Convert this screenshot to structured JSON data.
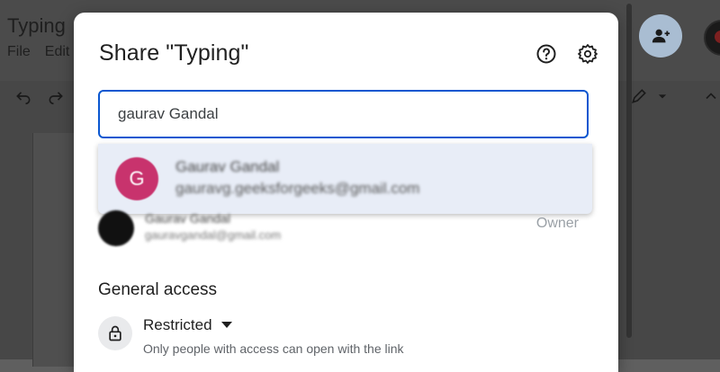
{
  "document": {
    "title": "Typing",
    "menu": [
      "File",
      "Edit"
    ]
  },
  "dialog": {
    "title": "Share \"Typing\"",
    "help_icon": "help-circle-icon",
    "settings_icon": "gear-icon"
  },
  "search": {
    "value": "gaurav Gandal"
  },
  "suggestion": {
    "initial": "G",
    "name": "Gaurav Gandal",
    "email": "gauravg.geeksforgeeks@gmail.com",
    "avatar_color": "#c8336d"
  },
  "owner": {
    "name": "Gaurav Gandal",
    "email": "gauravgandal@gmail.com",
    "role": "Owner"
  },
  "general_access": {
    "heading": "General access",
    "value": "Restricted",
    "description": "Only people with access can open with the link",
    "icon": "lock-icon"
  },
  "colors": {
    "accent": "#0b57d0",
    "suggestion_bg": "#e8edf7"
  }
}
